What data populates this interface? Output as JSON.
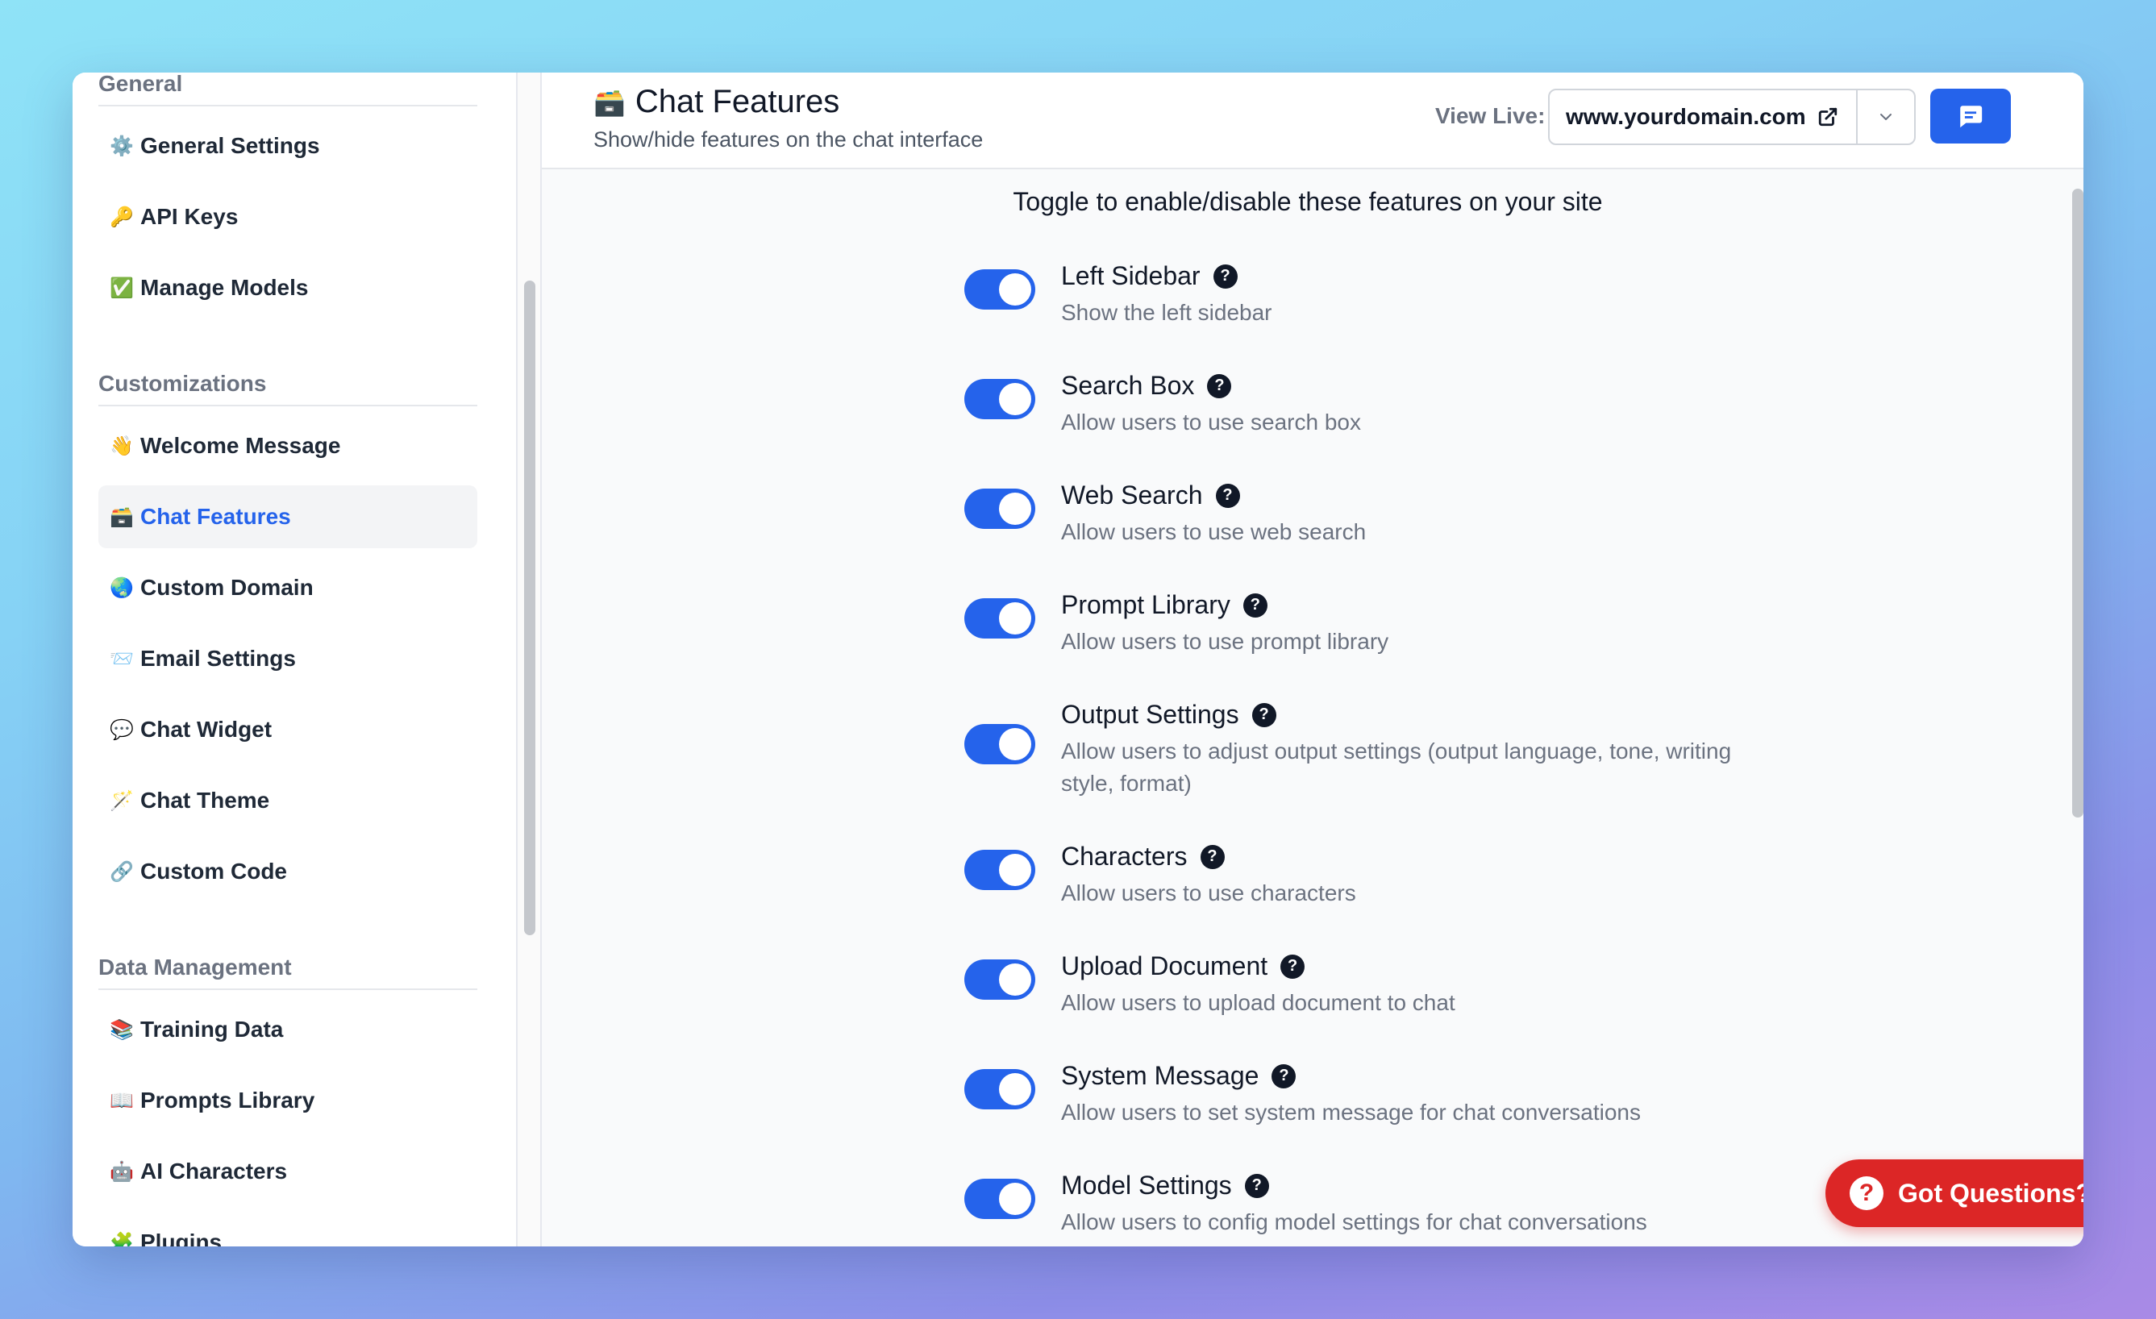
{
  "sidebar": {
    "sections": [
      {
        "title": "General",
        "items": [
          {
            "emoji": "⚙️",
            "label": "General Settings"
          },
          {
            "emoji": "🔑",
            "label": "API Keys"
          },
          {
            "emoji": "✅",
            "label": "Manage Models"
          }
        ]
      },
      {
        "title": "Customizations",
        "items": [
          {
            "emoji": "👋",
            "label": "Welcome Message"
          },
          {
            "emoji": "🗃️",
            "label": "Chat Features"
          },
          {
            "emoji": "🌏",
            "label": "Custom Domain"
          },
          {
            "emoji": "📨",
            "label": "Email Settings"
          },
          {
            "emoji": "💬",
            "label": "Chat Widget"
          },
          {
            "emoji": "🪄",
            "label": "Chat Theme"
          },
          {
            "emoji": "🔗",
            "label": "Custom Code"
          }
        ]
      },
      {
        "title": "Data Management",
        "items": [
          {
            "emoji": "📚",
            "label": "Training Data"
          },
          {
            "emoji": "📖",
            "label": "Prompts Library"
          },
          {
            "emoji": "🤖",
            "label": "AI Characters"
          },
          {
            "emoji": "🧩",
            "label": "Plugins"
          }
        ]
      }
    ],
    "active_item": "Chat Features"
  },
  "header": {
    "title_emoji": "🗃️",
    "title": "Chat Features",
    "subtitle": "Show/hide features on the chat interface",
    "view_live_label": "View Live:",
    "domain": "www.yourdomain.com"
  },
  "intro": "Toggle to enable/disable these features on your site",
  "features": [
    {
      "title": "Left Sidebar",
      "desc": "Show the left sidebar",
      "enabled": true
    },
    {
      "title": "Search Box",
      "desc": "Allow users to use search box",
      "enabled": true
    },
    {
      "title": "Web Search",
      "desc": "Allow users to use web search",
      "enabled": true
    },
    {
      "title": "Prompt Library",
      "desc": "Allow users to use prompt library",
      "enabled": true
    },
    {
      "title": "Output Settings",
      "desc": "Allow users to adjust output settings (output language, tone, writing style, format)",
      "enabled": true
    },
    {
      "title": "Characters",
      "desc": "Allow users to use characters",
      "enabled": true
    },
    {
      "title": "Upload Document",
      "desc": "Allow users to upload document to chat",
      "enabled": true
    },
    {
      "title": "System Message",
      "desc": "Allow users to set system message for chat conversations",
      "enabled": true
    },
    {
      "title": "Model Settings",
      "desc": "Allow users to config model settings for chat conversations",
      "enabled": true
    }
  ],
  "help_button": {
    "label": "Got Questions?",
    "icon": "?"
  },
  "colors": {
    "accent": "#2563eb",
    "help_button": "#dc2626"
  }
}
